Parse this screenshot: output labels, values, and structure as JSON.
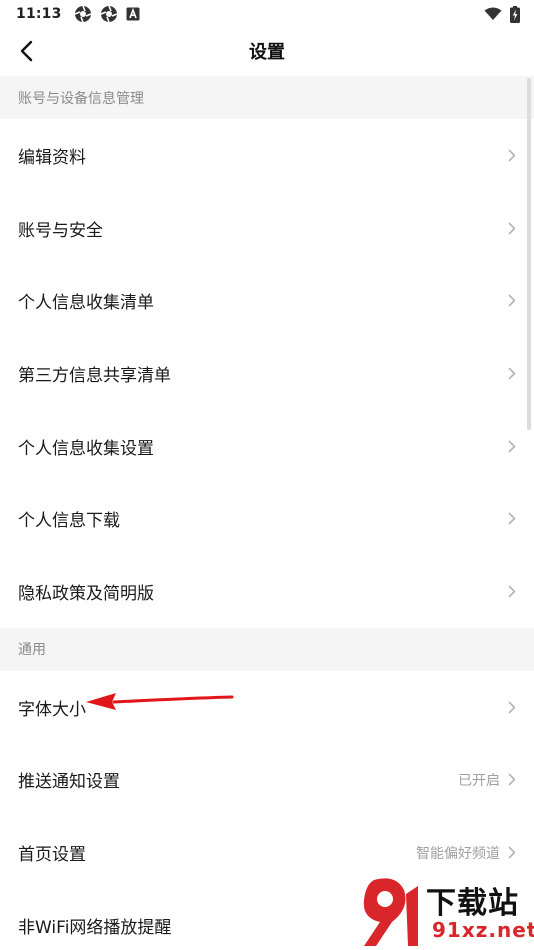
{
  "status_bar": {
    "time": "11:13",
    "left_icons": [
      "aperture-icon",
      "aperture-icon",
      "app-a-icon"
    ],
    "right_icons": [
      "wifi-icon",
      "battery-charging-icon"
    ]
  },
  "header": {
    "title": "设置",
    "back_icon": "chevron-left-icon"
  },
  "sections": [
    {
      "title": "账号与设备信息管理",
      "items": [
        {
          "label": "编辑资料"
        },
        {
          "label": "账号与安全"
        },
        {
          "label": "个人信息收集清单"
        },
        {
          "label": "第三方信息共享清单"
        },
        {
          "label": "个人信息收集设置"
        },
        {
          "label": "个人信息下载"
        },
        {
          "label": "隐私政策及简明版"
        }
      ]
    },
    {
      "title": "通用",
      "items": [
        {
          "label": "字体大小"
        },
        {
          "label": "推送通知设置",
          "value": "已开启"
        },
        {
          "label": "首页设置",
          "value": "智能偏好频道"
        },
        {
          "label": "非WiFi网络播放提醒"
        }
      ]
    }
  ],
  "watermark": {
    "logo_text": "下载站",
    "domain": "91xz.net"
  },
  "colors": {
    "section_bg": "#f5f5f5",
    "section_text": "#8a8a8a",
    "value_text": "#a0a0a0",
    "chevron": "#b5b5b5",
    "annotation_arrow": "#e0161b",
    "watermark_red": "#d8262b"
  }
}
